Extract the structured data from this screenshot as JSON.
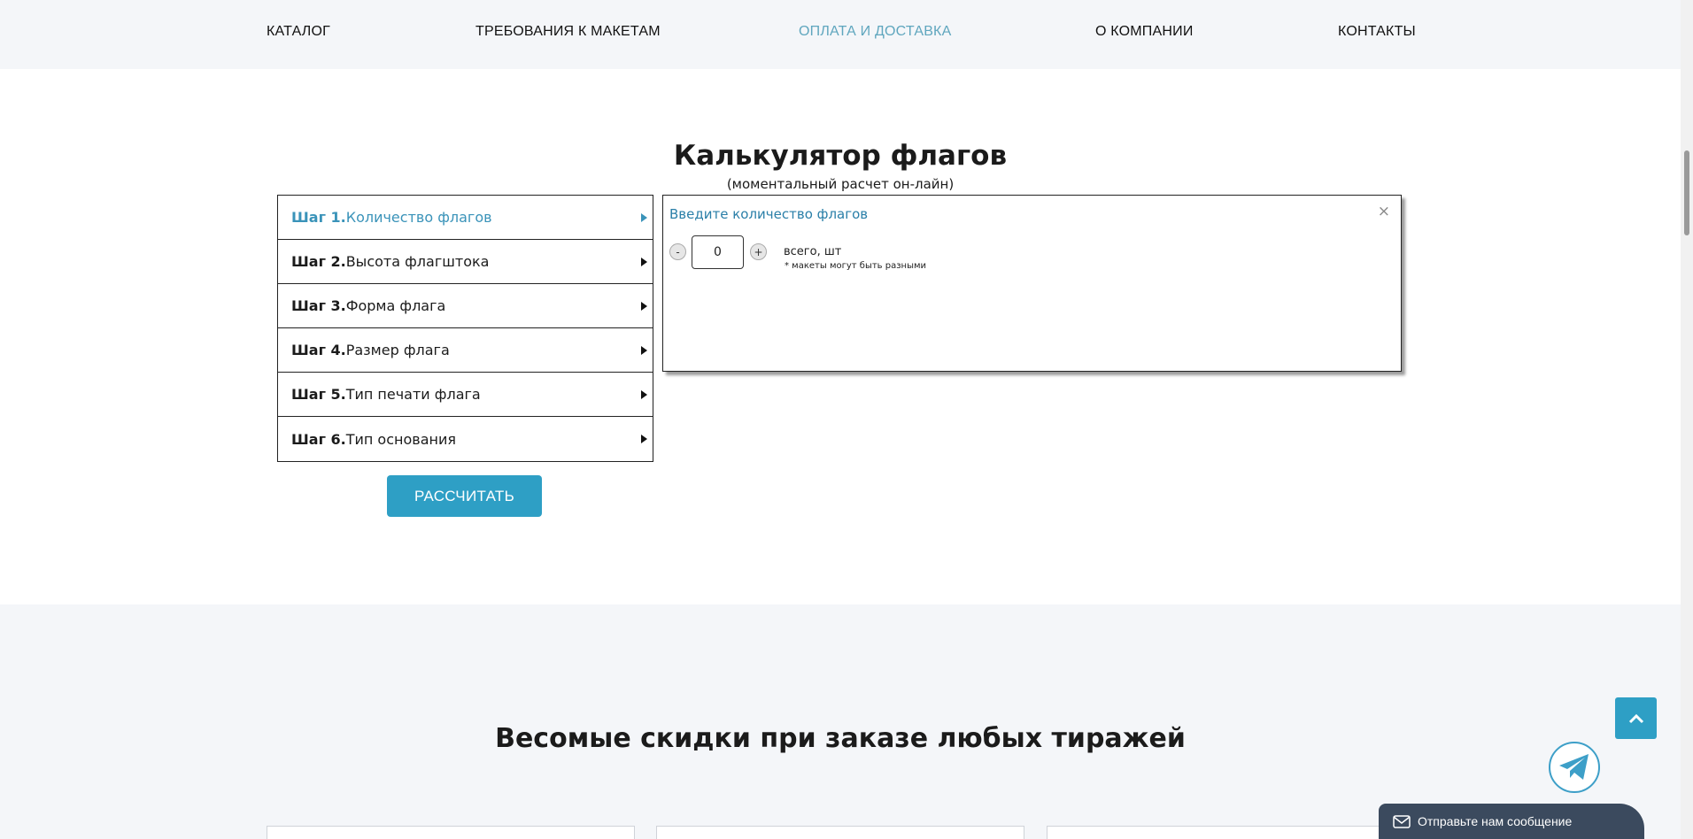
{
  "nav": {
    "items": [
      {
        "label": "КАТАЛОГ"
      },
      {
        "label": "ТРЕБОВАНИЯ К МАКЕТАМ"
      },
      {
        "label": "ОПЛАТА И ДОСТАВКА"
      },
      {
        "label": "О КОМПАНИИ"
      },
      {
        "label": "КОНТАКТЫ"
      }
    ],
    "active_color": "#5fa6be"
  },
  "calculator": {
    "title": "Калькулятор флагов",
    "subtitle": "(моментальный расчет он-лайн)",
    "steps": [
      {
        "num": "Шаг 1.",
        "label": "Количество флагов"
      },
      {
        "num": "Шаг 2.",
        "label": "Высота флагштока"
      },
      {
        "num": "Шаг 3.",
        "label": "Форма флага"
      },
      {
        "num": "Шаг 4.",
        "label": "Размер флага"
      },
      {
        "num": "Шаг 5.",
        "label": "Тип печати флага"
      },
      {
        "num": "Шаг 6.",
        "label": "Тип основания"
      }
    ],
    "active_step": 1,
    "calculate_label": "РАССЧИТАТЬ",
    "panel": {
      "title": "Введите количество флагов",
      "close": "×",
      "minus": "-",
      "plus": "+",
      "quantity": "0",
      "quantity_label": "всего, шт",
      "note": "* макеты могут быть разными"
    },
    "accent_color": "#2e9fc5"
  },
  "discounts": {
    "title": "Весомые скидки при заказе любых тиражей"
  },
  "widgets": {
    "to_top_icon": "chevron-up-icon",
    "telegram_icon": "telegram-icon",
    "message_icon": "mail-icon",
    "message_label": "Отправьте нам сообщение"
  }
}
